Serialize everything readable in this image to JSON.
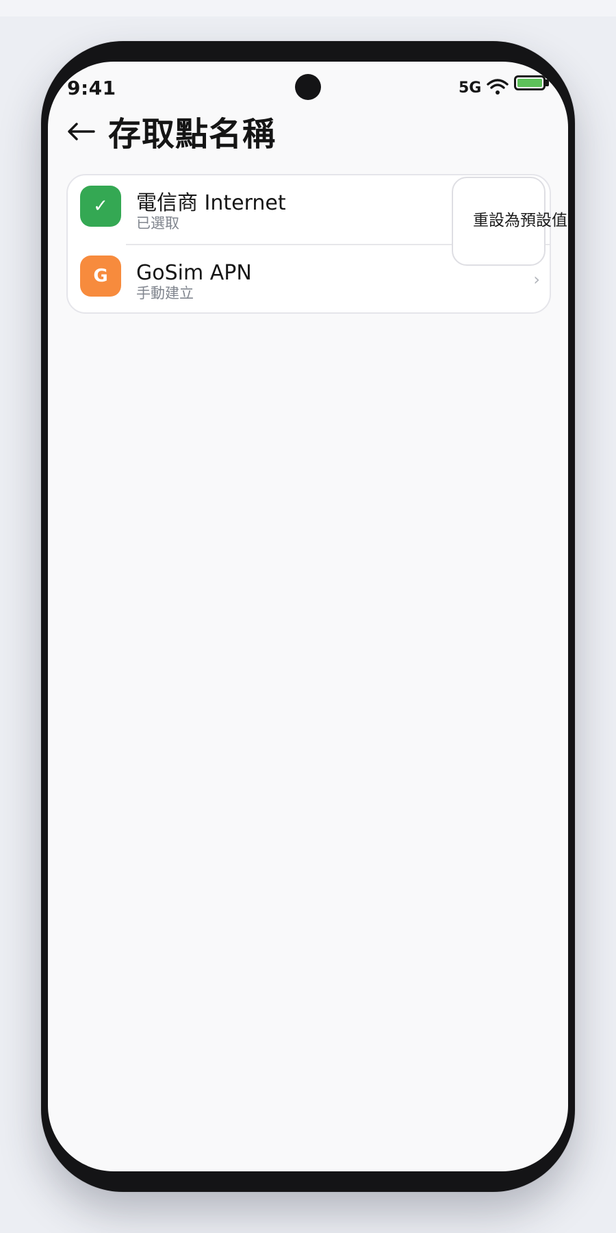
{
  "status_bar": {
    "time": "9:41",
    "network": "5G",
    "wifi_icon": "wifi-icon",
    "battery_icon": "battery-icon",
    "battery_color": "#5ec15a"
  },
  "header": {
    "back_icon": "back-arrow-icon",
    "title": "存取點名稱"
  },
  "apn_list": [
    {
      "icon": "check-icon",
      "icon_glyph": "✓",
      "icon_color": "#34a853",
      "title": "電信商 Internet",
      "subtitle": "已選取"
    },
    {
      "icon": "letter-g-icon",
      "icon_glyph": "G",
      "icon_color": "#f78b3d",
      "title": "GoSim APN",
      "subtitle": "手動建立",
      "chevron": "›"
    }
  ],
  "overflow_menu": {
    "item_label": "重設為預設值"
  }
}
